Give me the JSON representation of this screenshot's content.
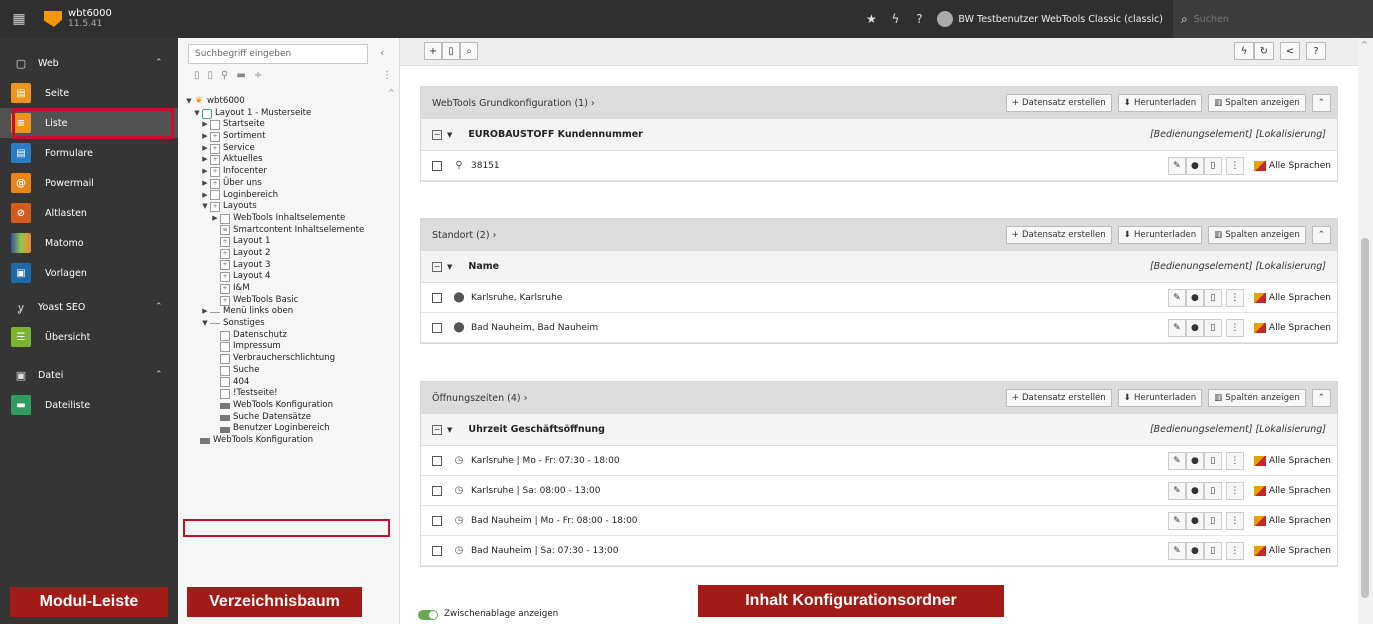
{
  "header": {
    "site_name": "wbt6000",
    "version": "11.5.41",
    "user": "BW Testbenutzer WebTools Classic (classic)",
    "search_placeholder": "Suchen"
  },
  "modules": {
    "web": "Web",
    "seite": "Seite",
    "liste": "Liste",
    "formulare": "Formulare",
    "powermail": "Powermail",
    "altlasten": "Altlasten",
    "matomo": "Matomo",
    "vorlagen": "Vorlagen",
    "yoast": "Yoast SEO",
    "uebersicht": "Übersicht",
    "datei": "Datei",
    "dateiliste": "Dateiliste"
  },
  "labels": {
    "modul_leiste": "Modul-Leiste",
    "verzeichnisbaum": "Verzeichnisbaum",
    "inhalt": "Inhalt Konfigurationsordner"
  },
  "tree": {
    "search_placeholder": "Suchbegriff eingeben",
    "nodes": [
      "wbt6000",
      "Layout 1 - Musterseite",
      "Startseite",
      "Sortiment",
      "Service",
      "Aktuelles",
      "Infocenter",
      "Über uns",
      "Loginbereich",
      "Layouts",
      "WebTools Inhaltselemente",
      "Smartcontent Inhaltselemente",
      "Layout 1",
      "Layout 2",
      "Layout 3",
      "Layout 4",
      "I&M",
      "WebTools Basic",
      "Menü links oben",
      "Sonstiges",
      "Datenschutz",
      "Impressum",
      "Verbraucherschlichtung",
      "Suche",
      "404",
      "!Testseite!",
      "WebTools Konfiguration",
      "Suche Datensätze",
      "Benutzer Loginbereich",
      "WebTools Konfiguration"
    ]
  },
  "common": {
    "create": "Datensatz erstellen",
    "download": "Herunterladen",
    "columns": "Spalten anzeigen",
    "col_right": "[Bedienungselement]  [Lokalisierung]",
    "all_languages": "Alle Sprachen"
  },
  "sections": [
    {
      "title": "WebTools Grundkonfiguration (1)  ›",
      "column": "EUROBAUSTOFF Kundennummer",
      "rows": [
        "38151"
      ]
    },
    {
      "title": "Standort (2)  ›",
      "column": "Name",
      "rows": [
        "Karlsruhe, Karlsruhe",
        "Bad Nauheim, Bad Nauheim"
      ]
    },
    {
      "title": "Öffnungszeiten (4)  ›",
      "column": "Uhrzeit Geschäftsöffnung",
      "rows": [
        "Karlsruhe | Mo - Fr: 07:30 - 18:00",
        "Karlsruhe | Sa: 08:00 - 13:00",
        "Bad Nauheim | Mo - Fr: 08:00 - 18:00",
        "Bad Nauheim | Sa: 07:30 - 13:00"
      ]
    }
  ],
  "clipboard": "Zwischenablage anzeigen"
}
